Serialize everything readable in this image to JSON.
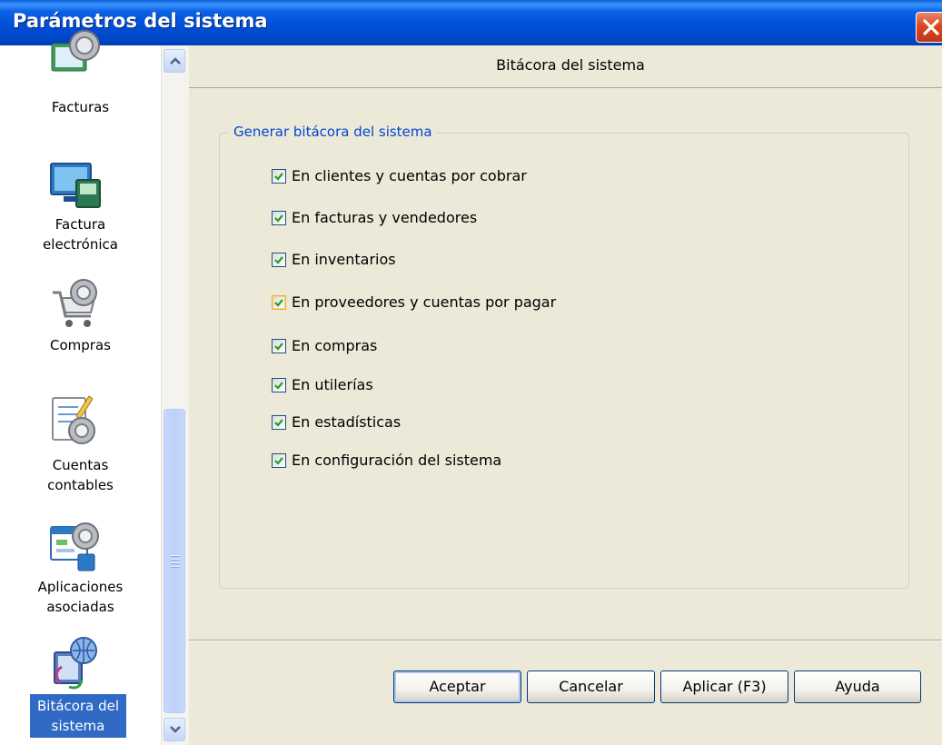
{
  "window": {
    "title": "Parámetros del sistema"
  },
  "nav": {
    "items": [
      {
        "id": "facturas",
        "lines": [
          "Facturas",
          ""
        ],
        "icon": "gear-invoice-icon"
      },
      {
        "id": "factura-electronica",
        "lines": [
          "Factura",
          "electrónica"
        ],
        "icon": "computer-monitor-icon"
      },
      {
        "id": "compras",
        "lines": [
          "Compras",
          ""
        ],
        "icon": "shopping-cart-icon"
      },
      {
        "id": "cuentas-contables",
        "lines": [
          "Cuentas",
          "contables"
        ],
        "icon": "ledger-pencil-icon"
      },
      {
        "id": "aplicaciones-asociadas",
        "lines": [
          "Aplicaciones",
          "asociadas"
        ],
        "icon": "app-window-icon"
      },
      {
        "id": "bitacora-del-sistema",
        "lines": [
          "Bitácora del",
          "sistema"
        ],
        "icon": "log-globe-icon",
        "selected": true
      }
    ]
  },
  "panel": {
    "header": "Bitácora del sistema",
    "group_title": "Generar bitácora del sistema",
    "options": [
      {
        "label": "En clientes y cuentas por cobrar",
        "checked": true
      },
      {
        "label": "En facturas y vendedores",
        "checked": true
      },
      {
        "label": "En inventarios",
        "checked": true
      },
      {
        "label": "En proveedores y cuentas por pagar",
        "checked": true,
        "focused": true
      },
      {
        "label": "En compras",
        "checked": true
      },
      {
        "label": "En utilerías",
        "checked": true
      },
      {
        "label": "En estadísticas",
        "checked": true
      },
      {
        "label": "En configuración del sistema",
        "checked": true
      }
    ]
  },
  "buttons": {
    "accept": "Aceptar",
    "cancel": "Cancelar",
    "apply": "Aplicar (F3)",
    "help": "Ayuda"
  },
  "colors": {
    "titlebar": "#0050D8",
    "selection": "#316AC5",
    "group_title": "#0046D5",
    "check": "#21A121",
    "close": "#D9491F"
  }
}
